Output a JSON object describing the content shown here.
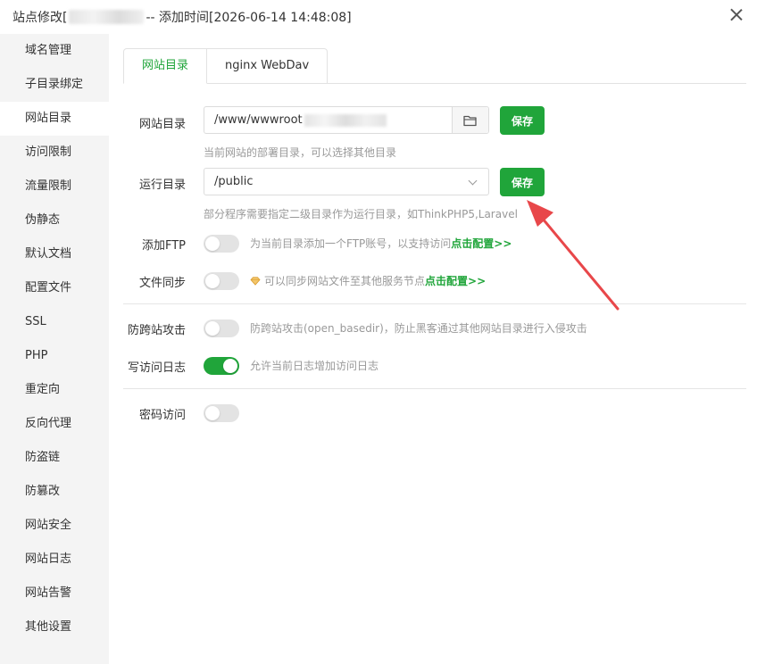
{
  "titlebar": {
    "prefix": "站点修改[",
    "suffix": "-- 添加时间[2026-06-14 14:48:08]"
  },
  "sidebar": {
    "items": [
      {
        "label": "域名管理"
      },
      {
        "label": "子目录绑定"
      },
      {
        "label": "网站目录"
      },
      {
        "label": "访问限制"
      },
      {
        "label": "流量限制"
      },
      {
        "label": "伪静态"
      },
      {
        "label": "默认文档"
      },
      {
        "label": "配置文件"
      },
      {
        "label": "SSL"
      },
      {
        "label": "PHP"
      },
      {
        "label": "重定向"
      },
      {
        "label": "反向代理"
      },
      {
        "label": "防盗链"
      },
      {
        "label": "防篡改"
      },
      {
        "label": "网站安全"
      },
      {
        "label": "网站日志"
      },
      {
        "label": "网站告警"
      },
      {
        "label": "其他设置"
      }
    ],
    "active_index": 2
  },
  "tabs": [
    {
      "label": "网站目录",
      "active": true
    },
    {
      "label": "nginx WebDav",
      "active": false
    }
  ],
  "site_dir": {
    "label": "网站目录",
    "value": "/www/wwwroot",
    "hint": "当前网站的部署目录，可以选择其他目录",
    "save_label": "保存"
  },
  "run_dir": {
    "label": "运行目录",
    "value": "/public",
    "hint": "部分程序需要指定二级目录作为运行目录，如ThinkPHP5,Laravel",
    "save_label": "保存"
  },
  "ftp": {
    "label": "添加FTP",
    "hint": "为当前目录添加一个FTP账号，以支持访问",
    "link": "点击配置",
    "arrows": ">>",
    "enabled": false
  },
  "sync": {
    "label": "文件同步",
    "hint": "可以同步网站文件至其他服务节点",
    "link": "点击配置",
    "arrows": ">>",
    "enabled": false
  },
  "cross_site": {
    "label": "防跨站攻击",
    "hint": "防跨站攻击(open_basedir)，防止黑客通过其他网站目录进行入侵攻击",
    "enabled": false
  },
  "access_log": {
    "label": "写访问日志",
    "hint": "允许当前日志增加访问日志",
    "enabled": true
  },
  "password": {
    "label": "密码访问",
    "enabled": false
  },
  "colors": {
    "accent": "#20a53a",
    "arrow": "#e8474a"
  }
}
